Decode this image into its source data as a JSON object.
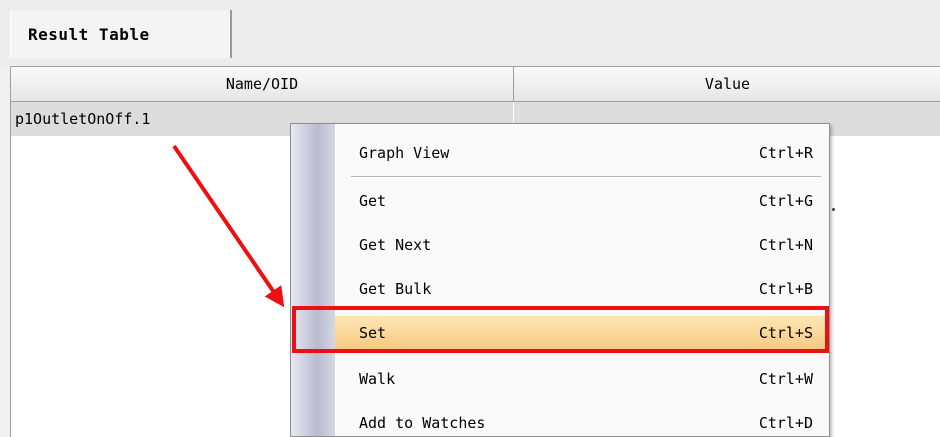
{
  "tab": {
    "label": "Result Table"
  },
  "table": {
    "columns": [
      "Name/OID",
      "Value"
    ],
    "rows": [
      {
        "name": "p1OutletOnOff.1",
        "value": ""
      }
    ]
  },
  "context_menu": {
    "items": [
      {
        "label": "Graph View",
        "shortcut": "Ctrl+R"
      },
      {
        "label": "Get",
        "shortcut": "Ctrl+G"
      },
      {
        "label": "Get Next",
        "shortcut": "Ctrl+N"
      },
      {
        "label": "Get Bulk",
        "shortcut": "Ctrl+B"
      },
      {
        "label": "Set",
        "shortcut": "Ctrl+S"
      },
      {
        "label": "Walk",
        "shortcut": "Ctrl+W"
      },
      {
        "label": "Add to Watches",
        "shortcut": "Ctrl+D"
      }
    ],
    "selected_index": 4
  },
  "colors": {
    "annotation_red": "#ee1010",
    "selected_item": "#f8c880"
  }
}
